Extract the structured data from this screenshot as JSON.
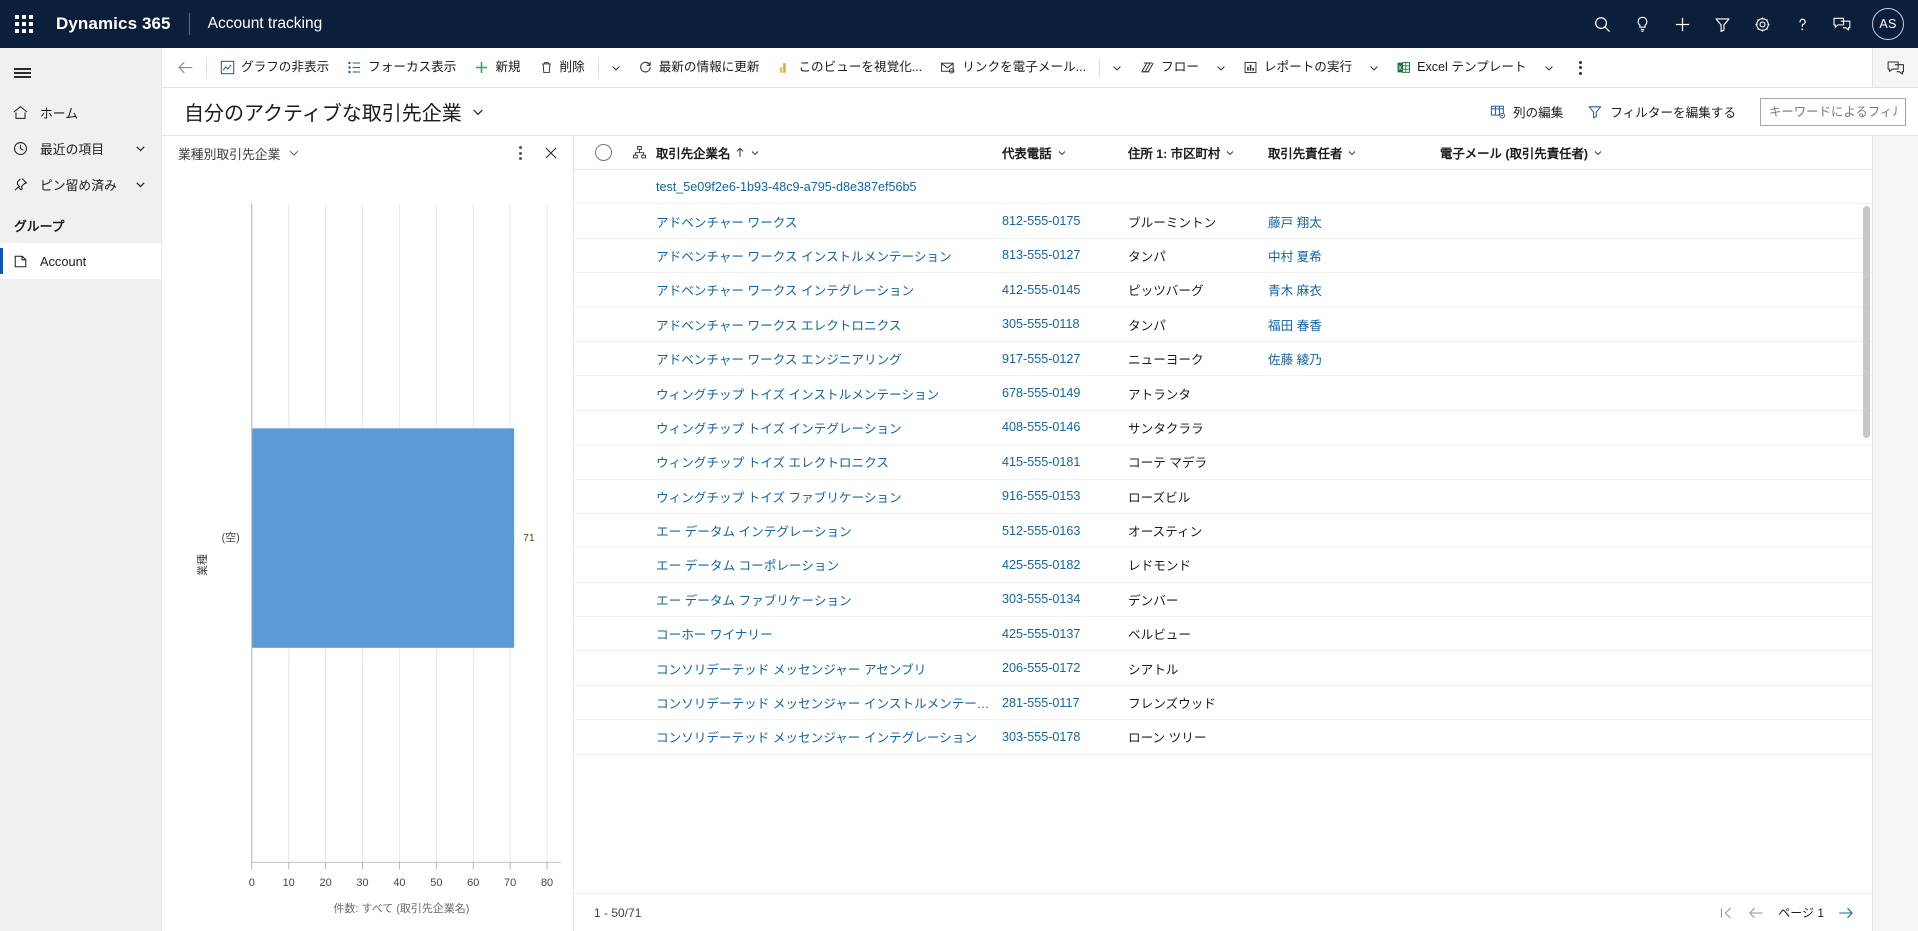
{
  "topbar": {
    "waffle_label": "app-launcher",
    "brand": "Dynamics 365",
    "app_name": "Account tracking",
    "icons": [
      "search-icon",
      "lightbulb-icon",
      "plus-icon",
      "filter-icon",
      "gear-icon",
      "help-icon",
      "feedback-icon"
    ],
    "avatar_initials": "AS"
  },
  "sidebar": {
    "hamburger_label": "サイト マップの展開/縮小",
    "items": [
      {
        "label": "ホーム",
        "icon": "home-icon",
        "chevron": false
      },
      {
        "label": "最近の項目",
        "icon": "clock-icon",
        "chevron": true
      },
      {
        "label": "ピン留め済み",
        "icon": "pin-icon",
        "chevron": true
      }
    ],
    "group_header": "グループ",
    "group_items": [
      {
        "label": "Account",
        "icon": "account-icon",
        "selected": true
      }
    ]
  },
  "commandbar": {
    "back_label": "戻る",
    "buttons": [
      {
        "label": "グラフの非表示",
        "icon": "chart-icon",
        "chevron": false
      },
      {
        "label": "フォーカス表示",
        "icon": "focus-icon",
        "chevron": false
      },
      {
        "label": "新規",
        "icon": "plus-green-icon",
        "chevron": false
      },
      {
        "label": "削除",
        "icon": "trash-icon",
        "chevron": true
      },
      {
        "label": "最新の情報に更新",
        "icon": "refresh-icon",
        "chevron": false
      },
      {
        "label": "このビューを視覚化...",
        "icon": "visualize-icon",
        "chevron": false
      },
      {
        "label": "リンクを電子メール...",
        "icon": "email-link-icon",
        "chevron": true
      },
      {
        "label": "フロー",
        "icon": "flow-icon",
        "chevron": true
      },
      {
        "label": "レポートの実行",
        "icon": "report-icon",
        "chevron": true
      },
      {
        "label": "Excel テンプレート",
        "icon": "excel-icon",
        "chevron": true
      }
    ],
    "overflow_label": "その他のコマンド"
  },
  "viewbar": {
    "title": "自分のアクティブな取引先企業",
    "title_chevron_label": "ビューの選択",
    "actions": [
      {
        "label": "列の編集",
        "icon": "edit-columns-icon"
      },
      {
        "label": "フィルターを編集する",
        "icon": "edit-filters-icon"
      }
    ],
    "search_placeholder": "キーワードによるフィルタ",
    "search_value": ""
  },
  "chart": {
    "title": "業種別取引先企業",
    "title_chevron_label": "グラフの選択",
    "kebab_label": "その他のグラフ コマンド",
    "close_label": "グラフを閉じる"
  },
  "chart_data": {
    "type": "bar",
    "orientation": "horizontal",
    "title": "業種別取引先企業",
    "categories": [
      "(空)"
    ],
    "values": [
      71
    ],
    "data_labels": [
      "71"
    ],
    "xlabel": "件数: すべて (取引先企業名)",
    "ylabel": "業種",
    "xlim": [
      0,
      80
    ],
    "xticks": [
      0,
      10,
      20,
      30,
      40,
      50,
      60,
      70,
      80
    ],
    "grid": true,
    "legend": "none",
    "bar_color": "#5b9bd5"
  },
  "grid": {
    "select_all_label": "すべて選択",
    "hierarchy_label": "階層",
    "columns": [
      {
        "key": "name",
        "label": "取引先企業名",
        "sorted": "asc",
        "chevron": true
      },
      {
        "key": "phone",
        "label": "代表電話",
        "chevron": true
      },
      {
        "key": "city",
        "label": "住所 1: 市区町村",
        "chevron": true
      },
      {
        "key": "primary",
        "label": "取引先責任者",
        "chevron": true
      },
      {
        "key": "email",
        "label": "電子メール (取引先責任者)",
        "chevron": true
      }
    ],
    "rows": [
      {
        "name": "test_5e09f2e6-1b93-48c9-a795-d8e387ef56b5",
        "phone": "",
        "city": "",
        "primary": "",
        "email": ""
      },
      {
        "name": "アドベンチャー ワークス",
        "phone": "812-555-0175",
        "city": "ブルーミントン",
        "primary": "藤戸 翔太",
        "email": ""
      },
      {
        "name": "アドベンチャー ワークス インストルメンテーション",
        "phone": "813-555-0127",
        "city": "タンパ",
        "primary": "中村 夏希",
        "email": ""
      },
      {
        "name": "アドベンチャー ワークス インテグレーション",
        "phone": "412-555-0145",
        "city": "ピッツバーグ",
        "primary": "青木 麻衣",
        "email": ""
      },
      {
        "name": "アドベンチャー ワークス エレクトロニクス",
        "phone": "305-555-0118",
        "city": "タンパ",
        "primary": "福田 春香",
        "email": ""
      },
      {
        "name": "アドベンチャー ワークス エンジニアリング",
        "phone": "917-555-0127",
        "city": "ニューヨーク",
        "primary": "佐藤 綾乃",
        "email": ""
      },
      {
        "name": "ウィングチップ トイズ インストルメンテーション",
        "phone": "678-555-0149",
        "city": "アトランタ",
        "primary": "",
        "email": ""
      },
      {
        "name": "ウィングチップ トイズ インテグレーション",
        "phone": "408-555-0146",
        "city": "サンタクララ",
        "primary": "",
        "email": ""
      },
      {
        "name": "ウィングチップ トイズ エレクトロニクス",
        "phone": "415-555-0181",
        "city": "コーテ マデラ",
        "primary": "",
        "email": ""
      },
      {
        "name": "ウィングチップ トイズ ファブリケーション",
        "phone": "916-555-0153",
        "city": "ローズビル",
        "primary": "",
        "email": ""
      },
      {
        "name": "エー データム インテグレーション",
        "phone": "512-555-0163",
        "city": "オースティン",
        "primary": "",
        "email": ""
      },
      {
        "name": "エー データム コーポレーション",
        "phone": "425-555-0182",
        "city": "レドモンド",
        "primary": "",
        "email": ""
      },
      {
        "name": "エー データム ファブリケーション",
        "phone": "303-555-0134",
        "city": "デンバー",
        "primary": "",
        "email": ""
      },
      {
        "name": "コーホー ワイナリー",
        "phone": "425-555-0137",
        "city": "ベルビュー",
        "primary": "",
        "email": ""
      },
      {
        "name": "コンソリデーテッド メッセンジャー アセンブリ",
        "phone": "206-555-0172",
        "city": "シアトル",
        "primary": "",
        "email": ""
      },
      {
        "name": "コンソリデーテッド メッセンジャー インストルメンテーション",
        "phone": "281-555-0117",
        "city": "フレンズウッド",
        "primary": "",
        "email": ""
      },
      {
        "name": "コンソリデーテッド メッセンジャー インテグレーション",
        "phone": "303-555-0178",
        "city": "ローン ツリー",
        "primary": "",
        "email": ""
      }
    ],
    "footer": {
      "range": "1 - 50/71",
      "page_label": "ページ 1",
      "first_label": "最初のページ",
      "prev_label": "前のページ",
      "next_label": "次のページ"
    }
  }
}
